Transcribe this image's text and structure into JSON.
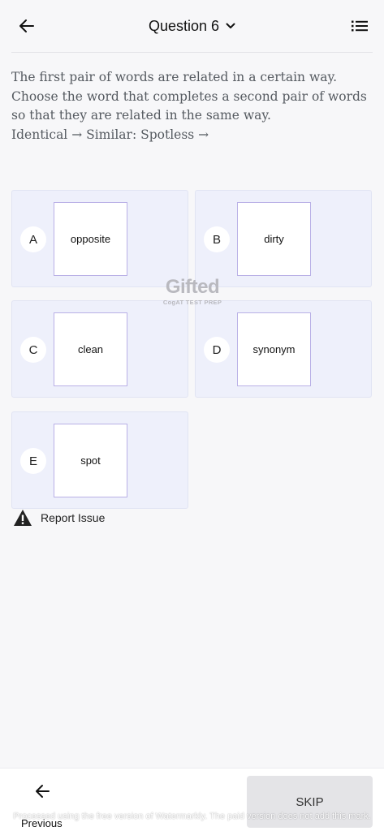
{
  "header": {
    "title": "Question 6",
    "back_icon": "arrow-left-icon",
    "dropdown_icon": "chevron-down-icon",
    "menu_icon": "list-icon"
  },
  "question": {
    "line1": "The first pair of words are related in a certain way. Choose the word that completes a second pair of words so that they are related in the same way.",
    "line2": "Identical → Similar: Spotless →"
  },
  "options": [
    {
      "letter": "A",
      "text": "opposite"
    },
    {
      "letter": "B",
      "text": "dirty"
    },
    {
      "letter": "C",
      "text": "clean"
    },
    {
      "letter": "D",
      "text": "synonym"
    },
    {
      "letter": "E",
      "text": "spot"
    }
  ],
  "watermark": {
    "main": "Gifted",
    "sub": "CogAT TEST PREP"
  },
  "report": {
    "label": "Report Issue",
    "icon": "warning-icon"
  },
  "bottom": {
    "previous_label": "Previous",
    "skip_label": "SKIP",
    "watermark_text": "Processed using the free version of Watermarkly. The paid version does not add this mark."
  },
  "colors": {
    "option_bg": "#eef0fb",
    "card_border": "#b9b0e6",
    "skip_bg": "#e4e4e7"
  }
}
